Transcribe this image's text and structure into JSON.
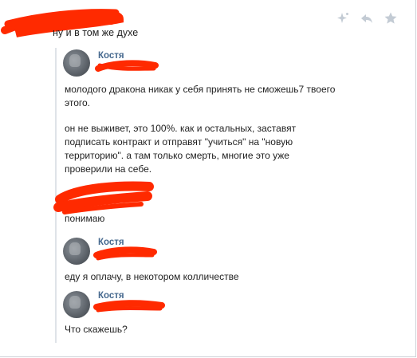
{
  "actions": {
    "icons": [
      "sparkle-icon",
      "reply-icon",
      "star-icon"
    ]
  },
  "top_message": {
    "text": "ну и в том же духе"
  },
  "forwarded": [
    {
      "author": "Костя",
      "paragraphs": [
        "молодого дракона никак у себя принять не сможешь7 твоего этого.",
        "он не выживет, это 100%. как и остальных, заставят подписать контракт и отправят \"учиться\" на \"новую территорию\". а там только смерть, многие это уже проверили на себе."
      ]
    },
    {
      "author": "",
      "text": "понимаю"
    },
    {
      "author": "Костя",
      "text": "еду я оплачу, в некотором колличестве"
    },
    {
      "author": "Костя",
      "text": "Что скажешь?"
    }
  ],
  "colors": {
    "author": "#45688e",
    "redaction": "#ff2a00",
    "quote_bar": "#dfe3e8"
  }
}
